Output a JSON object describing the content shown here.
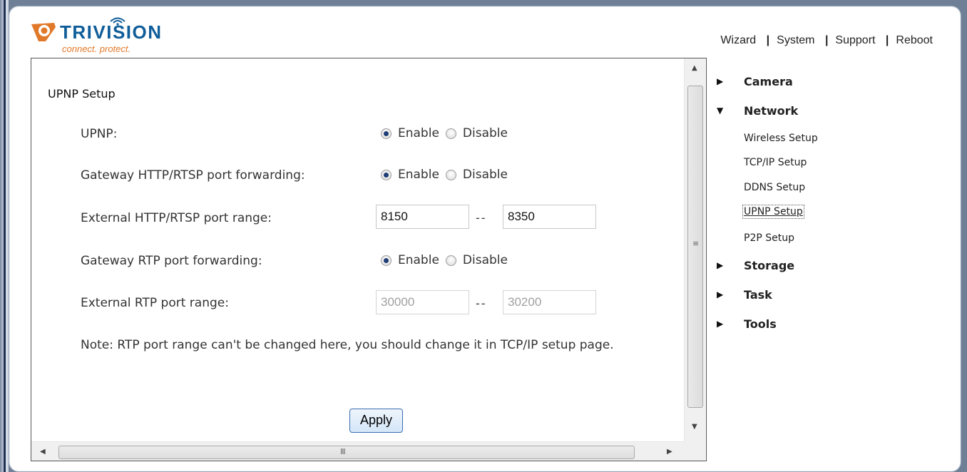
{
  "brand": {
    "name": "TRIVISION",
    "tagline": "connect. protect.",
    "primary_color": "#0f5d99",
    "accent_color": "#e1792a"
  },
  "top_links": [
    "Wizard",
    "System",
    "Support",
    "Reboot"
  ],
  "page_title": "UPNP Setup",
  "fields": {
    "upnp": {
      "label": "UPNP:",
      "options": [
        "Enable",
        "Disable"
      ],
      "selected": "Enable"
    },
    "gateway_http": {
      "label": "Gateway HTTP/RTSP port forwarding:",
      "options": [
        "Enable",
        "Disable"
      ],
      "selected": "Enable"
    },
    "external_http": {
      "label": "External HTTP/RTSP port range:",
      "from": "8150",
      "to": "8350",
      "separator": "--"
    },
    "gateway_rtp": {
      "label": "Gateway RTP port forwarding:",
      "options": [
        "Enable",
        "Disable"
      ],
      "selected": "Enable"
    },
    "external_rtp": {
      "label": "External RTP port range:",
      "from": "30000",
      "to": "30200",
      "separator": "--",
      "disabled": true
    }
  },
  "note": "Note: RTP port range can't be changed here, you should change it in TCP/IP setup page.",
  "apply_label": "Apply",
  "menu": {
    "camera": "Camera",
    "network": "Network",
    "network_items": [
      "Wireless Setup",
      "TCP/IP Setup",
      "DDNS Setup",
      "UPNP Setup",
      "P2P Setup"
    ],
    "network_active": "UPNP Setup",
    "storage": "Storage",
    "task": "Task",
    "tools": "Tools"
  },
  "icons": {
    "collapsed": "triangle-right-icon",
    "expanded": "triangle-down-icon",
    "logo": "camera-lens-icon",
    "wifi": "wifi-icon"
  }
}
